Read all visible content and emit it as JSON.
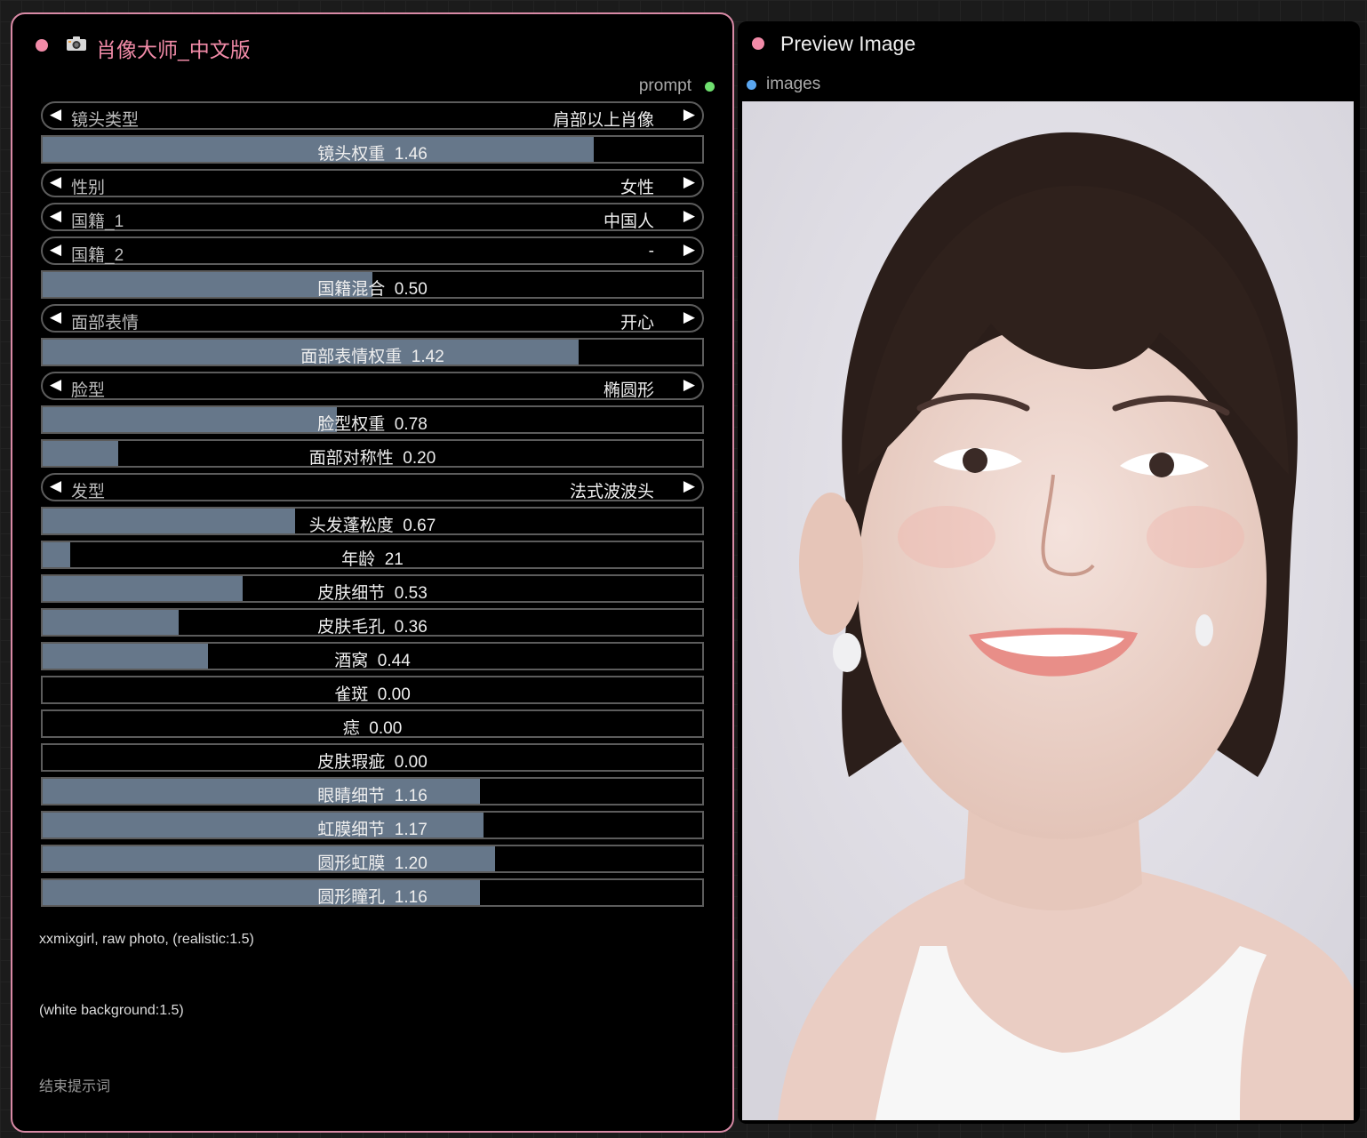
{
  "left_node": {
    "title": "肖像大师_中文版",
    "output_label": "prompt",
    "widgets": [
      {
        "kind": "combo",
        "label": "镜头类型",
        "value": "肩部以上肖像"
      },
      {
        "kind": "slider",
        "label": "镜头权重",
        "value": "1.46",
        "fill": 0.835
      },
      {
        "kind": "combo",
        "label": "性别",
        "value": "女性"
      },
      {
        "kind": "combo",
        "label": "国籍_1",
        "value": "中国人"
      },
      {
        "kind": "combo",
        "label": "国籍_2",
        "value": "-"
      },
      {
        "kind": "slider",
        "label": "国籍混合",
        "value": "0.50",
        "fill": 0.5
      },
      {
        "kind": "combo",
        "label": "面部表情",
        "value": "开心"
      },
      {
        "kind": "slider",
        "label": "面部表情权重",
        "value": "1.42",
        "fill": 0.812
      },
      {
        "kind": "combo",
        "label": "脸型",
        "value": "椭圆形"
      },
      {
        "kind": "slider",
        "label": "脸型权重",
        "value": "0.78",
        "fill": 0.446
      },
      {
        "kind": "slider",
        "label": "面部对称性",
        "value": "0.20",
        "fill": 0.114
      },
      {
        "kind": "combo",
        "label": "发型",
        "value": "法式波波头"
      },
      {
        "kind": "slider",
        "label": "头发蓬松度",
        "value": "0.67",
        "fill": 0.383
      },
      {
        "kind": "slider",
        "label": "年龄",
        "value": "21",
        "fill": 0.042
      },
      {
        "kind": "slider",
        "label": "皮肤细节",
        "value": "0.53",
        "fill": 0.303
      },
      {
        "kind": "slider",
        "label": "皮肤毛孔",
        "value": "0.36",
        "fill": 0.206
      },
      {
        "kind": "slider",
        "label": "酒窝",
        "value": "0.44",
        "fill": 0.251
      },
      {
        "kind": "slider",
        "label": "雀斑",
        "value": "0.00",
        "fill": 0
      },
      {
        "kind": "slider",
        "label": "痣",
        "value": "0.00",
        "fill": 0
      },
      {
        "kind": "slider",
        "label": "皮肤瑕疵",
        "value": "0.00",
        "fill": 0
      },
      {
        "kind": "slider",
        "label": "眼睛细节",
        "value": "1.16",
        "fill": 0.663
      },
      {
        "kind": "slider",
        "label": "虹膜细节",
        "value": "1.17",
        "fill": 0.669
      },
      {
        "kind": "slider",
        "label": "圆形虹膜",
        "value": "1.20",
        "fill": 0.686
      },
      {
        "kind": "slider",
        "label": "圆形瞳孔",
        "value": "1.16",
        "fill": 0.663
      }
    ],
    "prompt_start": "xxmixgirl, raw photo, (realistic:1.5)",
    "prompt_middle": "(white background:1.5)",
    "end_prompt_placeholder": "结束提示词"
  },
  "right_node": {
    "title": "Preview Image",
    "input_label": "images"
  },
  "colors": {
    "node_title_pink": "#f28ba8",
    "slider_fill": "#66778a",
    "output_dot": "#6fe06f",
    "input_dot": "#5aa6f0"
  }
}
